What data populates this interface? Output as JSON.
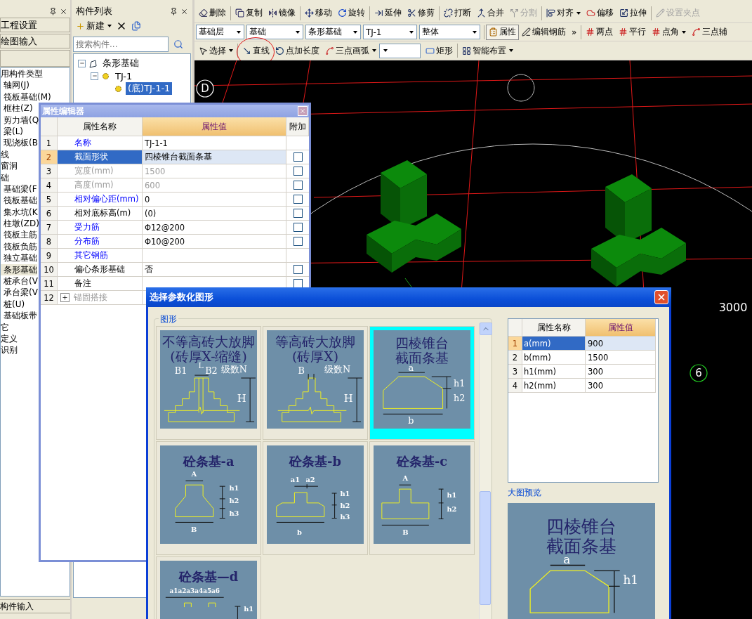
{
  "left_panel": {
    "buttons": [
      "工程设置",
      "绘图输入"
    ],
    "items": [
      {
        "label": "用构件类型",
        "kind": "group"
      },
      {
        "label": "轴网(J)",
        "kind": "item"
      },
      {
        "label": "筏板基础(M)",
        "kind": "item"
      },
      {
        "label": "框柱(Z)",
        "kind": "item"
      },
      {
        "label": "剪力墙(Q",
        "kind": "item"
      },
      {
        "label": "梁(L)",
        "kind": "item"
      },
      {
        "label": "现浇板(B",
        "kind": "item"
      },
      {
        "label": "线",
        "kind": "group"
      },
      {
        "label": "窗洞",
        "kind": "group"
      },
      {
        "label": "础",
        "kind": "group"
      },
      {
        "label": "基础梁(F",
        "kind": "item"
      },
      {
        "label": "筏板基础",
        "kind": "item"
      },
      {
        "label": "集水坑(K",
        "kind": "item"
      },
      {
        "label": "柱墩(ZD)",
        "kind": "item"
      },
      {
        "label": "筏板主筋",
        "kind": "item"
      },
      {
        "label": "筏板负筋",
        "kind": "item"
      },
      {
        "label": "独立基础",
        "kind": "item"
      },
      {
        "label": "条形基础",
        "kind": "item",
        "selected": true
      },
      {
        "label": "桩承台(V",
        "kind": "item"
      },
      {
        "label": "承台梁(V",
        "kind": "item"
      },
      {
        "label": "桩(U)",
        "kind": "item"
      },
      {
        "label": "基础板带",
        "kind": "item"
      },
      {
        "label": "它",
        "kind": "group"
      },
      {
        "label": "定义",
        "kind": "group"
      },
      {
        "label": "识别",
        "kind": "group"
      }
    ],
    "bottom_tab": "构件输入"
  },
  "component_list": {
    "title": "构件列表",
    "new_button": "新建",
    "search": {
      "placeholder": "搜索构件..."
    },
    "tree": [
      {
        "label": "条形基础",
        "expanded": true,
        "selected": false,
        "children": [
          {
            "label": "TJ-1",
            "expanded": true,
            "selected": false,
            "children": [
              {
                "label": "(底)TJ-1-1",
                "selected": true
              }
            ]
          }
        ]
      }
    ]
  },
  "toolbar": {
    "row_1": [
      {
        "label": "删除",
        "disabled": false,
        "menu": false
      },
      {
        "label": "复制",
        "disabled": false,
        "menu": false
      },
      {
        "label": "镜像",
        "disabled": false,
        "menu": false
      },
      {
        "label": "移动",
        "disabled": false,
        "menu": false
      },
      {
        "label": "旋转",
        "disabled": false,
        "menu": false
      },
      {
        "label": "延伸",
        "disabled": false,
        "menu": false
      },
      {
        "label": "修剪",
        "disabled": false,
        "menu": false
      },
      {
        "label": "打断",
        "disabled": false,
        "menu": false
      },
      {
        "label": "合并",
        "disabled": false,
        "menu": false
      },
      {
        "label": "分割",
        "disabled": true,
        "menu": false
      },
      {
        "label": "对齐",
        "disabled": false,
        "menu": true
      },
      {
        "label": "偏移",
        "disabled": false,
        "menu": false
      },
      {
        "label": "拉伸",
        "disabled": false,
        "menu": false
      },
      {
        "label": "设置夹点",
        "disabled": true,
        "menu": false
      }
    ],
    "row_2": [
      {
        "kind": "combo",
        "value": "基础层"
      },
      {
        "kind": "combo",
        "value": "基础"
      },
      {
        "kind": "combo",
        "value": "条形基础"
      },
      {
        "kind": "combo",
        "value": "TJ-1"
      },
      {
        "kind": "combo",
        "value": "整体"
      },
      {
        "kind": "button",
        "label": "属性",
        "pressed": true,
        "menu": false
      },
      {
        "kind": "button",
        "label": "编辑钢筋",
        "pressed": false,
        "menu": false
      },
      {
        "kind": "button",
        "label": "»",
        "pressed": false,
        "menu": false
      },
      {
        "kind": "button",
        "label": "两点",
        "pressed": false,
        "menu": false
      },
      {
        "kind": "button",
        "label": "平行",
        "pressed": false,
        "menu": false
      },
      {
        "kind": "button",
        "label": "点角",
        "pressed": false,
        "menu": true
      },
      {
        "kind": "button",
        "label": "三点辅",
        "pressed": false,
        "menu": false
      }
    ],
    "row_3": [
      {
        "kind": "button",
        "label": "选择",
        "menu": true,
        "circled": false
      },
      {
        "kind": "button",
        "label": "直线",
        "menu": false,
        "circled": true
      },
      {
        "kind": "button",
        "label": "点加长度",
        "menu": false,
        "circled": false
      },
      {
        "kind": "button",
        "label": "三点画弧",
        "menu": true,
        "circled": false
      },
      {
        "kind": "combo"
      },
      {
        "kind": "button",
        "label": "矩形",
        "menu": false,
        "circled": false
      },
      {
        "kind": "button",
        "label": "智能布置",
        "menu": true,
        "circled": false
      }
    ]
  },
  "viewport": {
    "labels": [
      {
        "kind": "bubble",
        "text": "D"
      },
      {
        "kind": "dimension",
        "text": "3000"
      },
      {
        "kind": "bubble",
        "text": "6"
      }
    ]
  },
  "property_editor": {
    "title": "属性编辑器",
    "columns": [
      "属性名称",
      "属性值",
      "附加"
    ],
    "rows": [
      {
        "num": "1",
        "name": "名称",
        "value": "TJ-1-1",
        "kind": "field",
        "public": true,
        "disabled": false,
        "selected": false
      },
      {
        "num": "2",
        "name": "截面形状",
        "value": "四棱锥台截面条基",
        "kind": "check",
        "checked": false,
        "public": false,
        "disabled": false,
        "selected": true
      },
      {
        "num": "3",
        "name": "宽度(mm)",
        "value": "1500",
        "kind": "check",
        "checked": false,
        "public": false,
        "disabled": true,
        "selected": false
      },
      {
        "num": "4",
        "name": "高度(mm)",
        "value": "600",
        "kind": "check",
        "checked": false,
        "public": false,
        "disabled": true,
        "selected": false
      },
      {
        "num": "5",
        "name": "相对偏心距(mm)",
        "value": "0",
        "kind": "check",
        "checked": false,
        "public": true,
        "disabled": false,
        "selected": false
      },
      {
        "num": "6",
        "name": "相对底标高(m)",
        "value": "(0)",
        "kind": "check",
        "checked": false,
        "public": false,
        "disabled": false,
        "selected": false
      },
      {
        "num": "7",
        "name": "受力筋",
        "value": "Φ12@200",
        "kind": "check",
        "checked": false,
        "public": true,
        "disabled": false,
        "selected": false
      },
      {
        "num": "8",
        "name": "分布筋",
        "value": "Φ10@200",
        "kind": "check",
        "checked": false,
        "public": true,
        "disabled": false,
        "selected": false
      },
      {
        "num": "9",
        "name": "其它钢筋",
        "kind": "field",
        "public": true,
        "disabled": false,
        "selected": false
      },
      {
        "num": "10",
        "name": "偏心条形基础",
        "value": "否",
        "kind": "check",
        "checked": false,
        "public": false,
        "disabled": false,
        "selected": false
      },
      {
        "num": "11",
        "name": "备注",
        "kind": "check",
        "checked": false,
        "public": false,
        "disabled": false,
        "selected": false
      },
      {
        "num": "12",
        "name": "锚固搭接",
        "kind": "group",
        "expanded": false,
        "public": false,
        "disabled": true,
        "selected": false
      }
    ]
  },
  "dialog": {
    "title": "选择参数化图形",
    "shapes_group": "图形",
    "shapes": [
      {
        "kind": "brick-unequal",
        "title": [
          "不等高砖大放脚",
          "(砖厚X-缩缝)"
        ],
        "labels": [
          "B1",
          "L",
          "B2",
          "级数N",
          "H"
        ],
        "selected": false
      },
      {
        "kind": "brick-equal",
        "title": [
          "等高砖大放脚",
          "(砖厚X)"
        ],
        "labels": [
          "B",
          "级数N",
          "H"
        ],
        "selected": false
      },
      {
        "kind": "frustum",
        "title": [
          "四棱锥台",
          "截面条基"
        ],
        "labels": [
          "a",
          "h1",
          "h2",
          "b"
        ],
        "selected": true
      },
      {
        "kind": "concrete-a",
        "title": [
          "砼条基-a"
        ],
        "labels": [
          "A",
          "h1",
          "h2",
          "h3",
          "B"
        ],
        "selected": false
      },
      {
        "kind": "concrete-b",
        "title": [
          "砼条基-b"
        ],
        "labels": [
          "a1",
          "a2",
          "h1",
          "h2",
          "h3",
          "b"
        ],
        "selected": false
      },
      {
        "kind": "concrete-c",
        "title": [
          "砼条基-c"
        ],
        "labels": [
          "A",
          "h1",
          "h2",
          "B"
        ],
        "selected": false
      },
      {
        "kind": "concrete-d",
        "title": [
          "砼条基—d"
        ],
        "labels": [
          "a1a2a3a4a5a6",
          "h1"
        ],
        "selected": false
      }
    ],
    "params": {
      "columns": [
        "属性名称",
        "属性值"
      ],
      "rows": [
        {
          "num": "1",
          "name": "a(mm)",
          "value": "900",
          "selected": true
        },
        {
          "num": "2",
          "name": "b(mm)",
          "value": "1500",
          "selected": false
        },
        {
          "num": "3",
          "name": "h1(mm)",
          "value": "300",
          "selected": false
        },
        {
          "num": "4",
          "name": "h2(mm)",
          "value": "300",
          "selected": false
        }
      ]
    },
    "preview_label": "大图预览",
    "preview": {
      "kind": "frustum",
      "title": [
        "四棱锥台",
        "截面条基"
      ],
      "labels": [
        "a",
        "h1"
      ]
    }
  }
}
